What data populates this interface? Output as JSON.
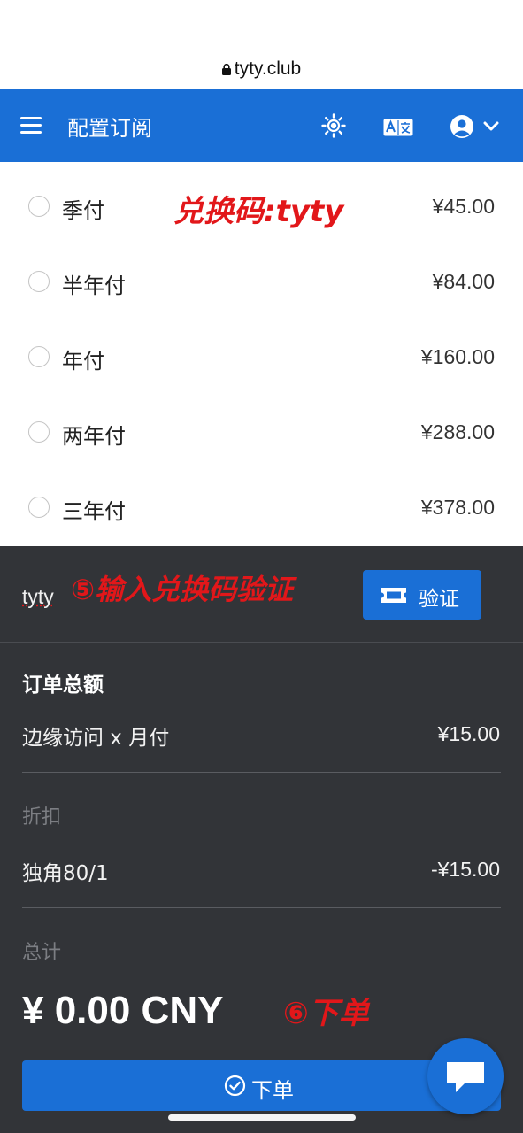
{
  "browser": {
    "url": "tyty.club"
  },
  "header": {
    "title": "配置订阅",
    "icons": [
      "menu-icon",
      "brightness-icon",
      "translate-icon",
      "account-icon",
      "chevron-down-icon"
    ]
  },
  "plans": [
    {
      "label": "季付",
      "price": "¥45.00"
    },
    {
      "label": "半年付",
      "price": "¥84.00"
    },
    {
      "label": "年付",
      "price": "¥160.00"
    },
    {
      "label": "两年付",
      "price": "¥288.00"
    },
    {
      "label": "三年付",
      "price": "¥378.00"
    }
  ],
  "annotations": {
    "coupon_code": "兑换码:tyty",
    "step5": "⑤输入兑换码验证",
    "step6": "⑥下单"
  },
  "coupon": {
    "value": "tyty",
    "verify_label": "验证"
  },
  "summary": {
    "title": "订单总额",
    "item_label": "边缘访问 x 月付",
    "item_value": "¥15.00",
    "discount_heading": "折扣",
    "discount_label": "独角80/1",
    "discount_value": "-¥15.00",
    "total_heading": "总计",
    "total_amount": "¥ 0.00 CNY"
  },
  "order_button": {
    "label": "下单"
  },
  "colors": {
    "primary": "#1a6fd6",
    "dark_panel": "#323438",
    "annotation_red": "#e2171a"
  }
}
